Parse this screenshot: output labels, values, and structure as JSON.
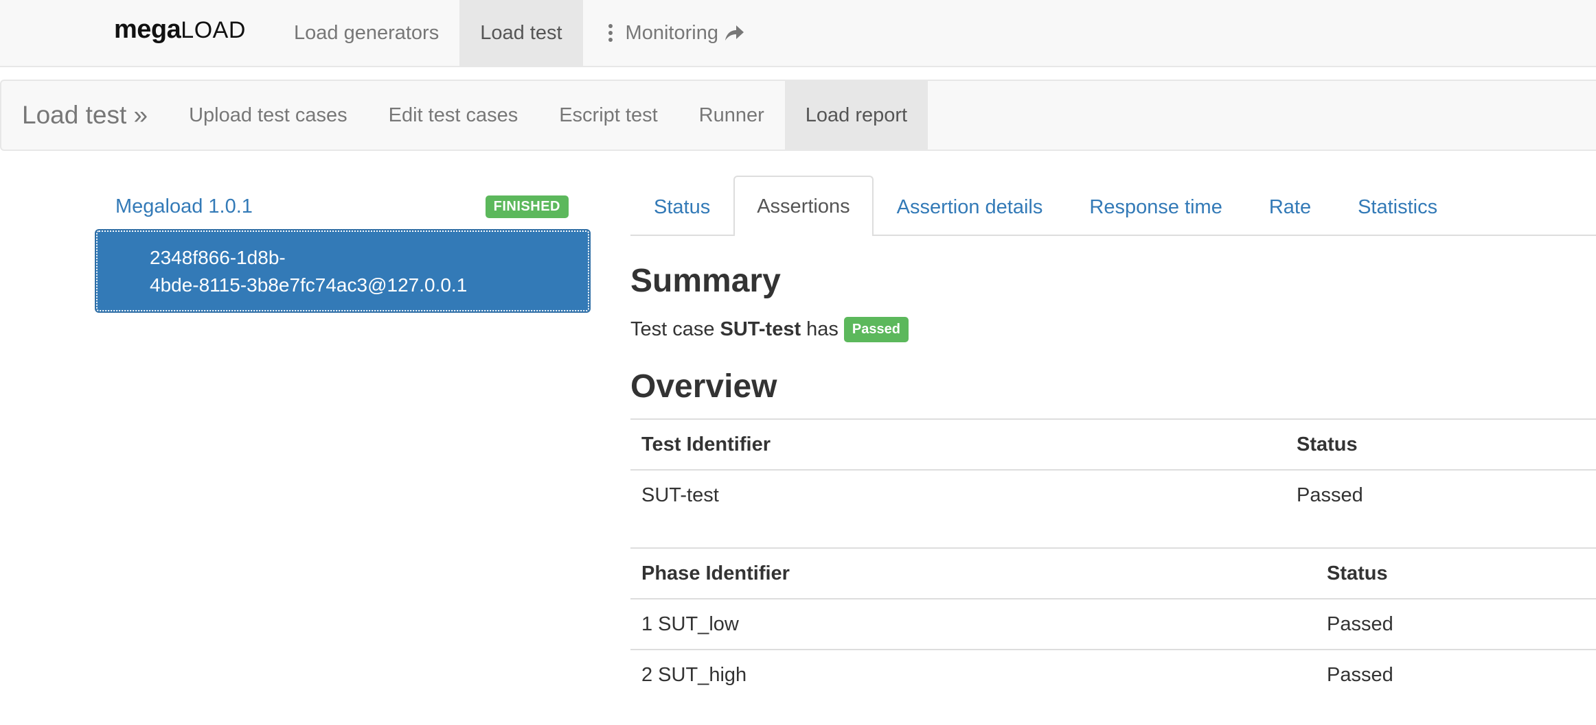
{
  "topnav": {
    "brand_mega": "mega",
    "brand_load": "LOAD",
    "items": [
      {
        "label": "Load generators",
        "active": false
      },
      {
        "label": "Load test",
        "active": true
      },
      {
        "label": "Monitoring",
        "active": false,
        "icons": [
          "kebab-icon",
          "share-arrow-icon"
        ]
      }
    ]
  },
  "subnav": {
    "brand": "Load test »",
    "items": [
      {
        "label": "Upload test cases",
        "active": false
      },
      {
        "label": "Edit test cases",
        "active": false
      },
      {
        "label": "Escript test",
        "active": false
      },
      {
        "label": "Runner",
        "active": false
      },
      {
        "label": "Load report",
        "active": true
      }
    ]
  },
  "sidebar": {
    "test_link": "Megaload 1.0.1",
    "status_badge": "FINISHED",
    "selected_node_line1": "2348f866-1d8b-",
    "selected_node_line2": "4bde-8115-3b8e7fc74ac3@127.0.0.1"
  },
  "tabs": [
    {
      "label": "Status",
      "active": false
    },
    {
      "label": "Assertions",
      "active": true
    },
    {
      "label": "Assertion details",
      "active": false
    },
    {
      "label": "Response time",
      "active": false
    },
    {
      "label": "Rate",
      "active": false
    },
    {
      "label": "Statistics",
      "active": false
    }
  ],
  "summary": {
    "title": "Summary",
    "prefix": "Test case",
    "test_case": "SUT-test",
    "verb": "has",
    "result_badge": "Passed"
  },
  "overview": {
    "title": "Overview",
    "test_table": {
      "headers": [
        "Test Identifier",
        "Status"
      ],
      "rows": [
        [
          "SUT-test",
          "Passed"
        ]
      ]
    },
    "phase_table": {
      "headers": [
        "Phase Identifier",
        "Status"
      ],
      "rows": [
        [
          "1 SUT_low",
          "Passed"
        ],
        [
          "2 SUT_high",
          "Passed"
        ]
      ]
    }
  },
  "colors": {
    "link": "#337ab7",
    "success": "#5cb85c",
    "navbar_bg": "#f8f8f8",
    "active_bg": "#e7e7e7"
  }
}
